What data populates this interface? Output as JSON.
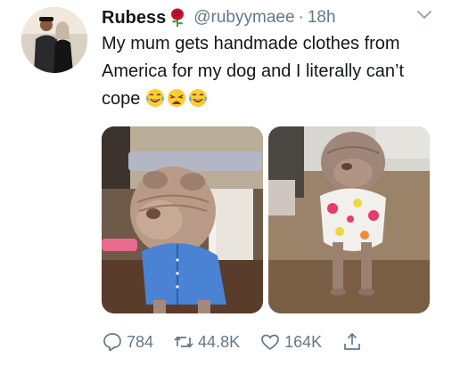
{
  "author": {
    "name": "Rubess",
    "handle": "@rubyymaee",
    "separator": "·",
    "time": "18h",
    "name_badge_icon": "rose-icon"
  },
  "tweet": {
    "text": "My mum gets handmade clothes from America for my dog and I literally can’t cope",
    "emojis": [
      "tears-of-joy-emoji",
      "weary-face-emoji",
      "tears-of-joy-emoji"
    ]
  },
  "media": {
    "count": 2,
    "photos": [
      "dog-in-blue-shirt-photo",
      "dog-in-floral-shirt-photo"
    ]
  },
  "actions": {
    "replies": "784",
    "retweets": "44.8K",
    "likes": "164K"
  },
  "colors": {
    "text": "#14171a",
    "secondary": "#657786",
    "rose": "#c0162c"
  }
}
